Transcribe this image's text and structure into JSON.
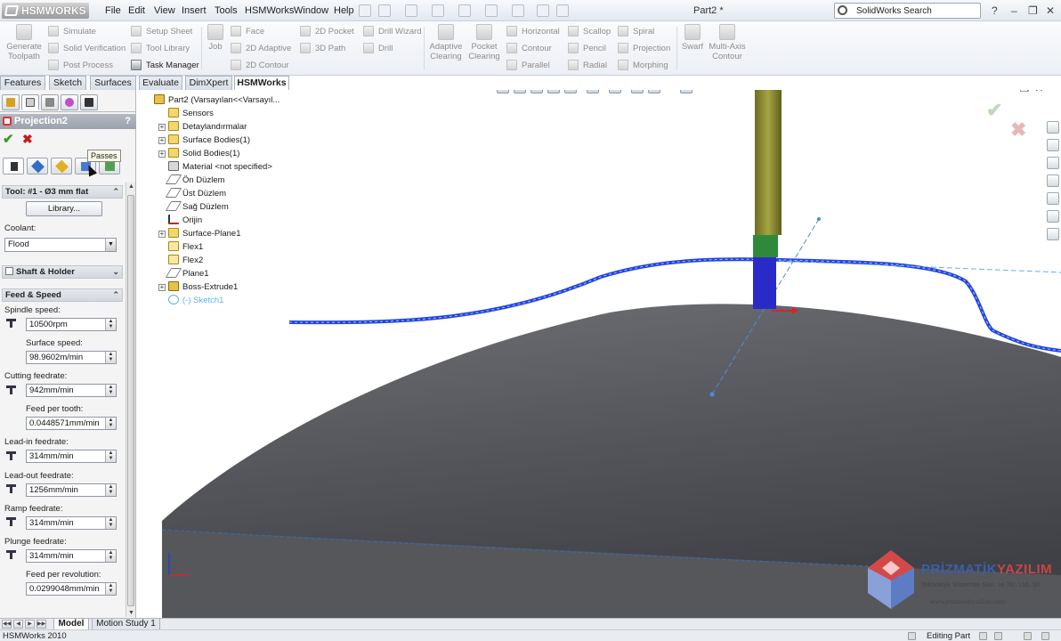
{
  "app": {
    "brand": "HSMWORKS",
    "document_title": "Part2 *"
  },
  "menu": [
    "File",
    "Edit",
    "View",
    "Insert",
    "Tools",
    "HSMWorks",
    "Window",
    "Help"
  ],
  "search": {
    "placeholder": "SolidWorks Search"
  },
  "command_manager": {
    "generate": "Generate Toolpath",
    "col1": [
      "Simulate",
      "Solid Verification",
      "Post Process"
    ],
    "col2": [
      "Setup Sheet",
      "Tool Library",
      "Task Manager"
    ],
    "job": "Job",
    "col3": [
      "Face",
      "2D Adaptive",
      "2D Contour"
    ],
    "col4": [
      "2D Pocket",
      "3D Path"
    ],
    "col5": [
      "Drill Wizard",
      "Drill"
    ],
    "adaptive": "Adaptive Clearing",
    "pocket": "Pocket Clearing",
    "col6": [
      "Horizontal",
      "Contour",
      "Parallel"
    ],
    "col7": [
      "Scallop",
      "Pencil",
      "Radial"
    ],
    "col8": [
      "Spiral",
      "Projection",
      "Morphing"
    ],
    "swarf": "Swarf",
    "multiaxis": "Multi-Axis Contour"
  },
  "tabs": [
    "Features",
    "Sketch",
    "Surfaces",
    "Evaluate",
    "DimXpert",
    "HSMWorks"
  ],
  "active_tab": "HSMWorks",
  "panel": {
    "title": "Projection2",
    "help": "?",
    "tooltip": "Passes",
    "tool_section": "Tool: #1 - Ø3 mm flat",
    "library_button": "Library...",
    "coolant_label": "Coolant:",
    "coolant_value": "Flood",
    "shaft_section": "Shaft & Holder",
    "feed_section": "Feed & Speed",
    "fields": [
      {
        "label": "Spindle speed:",
        "value": "10500rpm"
      },
      {
        "label": "Surface speed:",
        "value": "98.9602m/min"
      },
      {
        "label": "Cutting feedrate:",
        "value": "942mm/min"
      },
      {
        "label": "Feed per tooth:",
        "value": "0.0448571mm/min"
      },
      {
        "label": "Lead-in feedrate:",
        "value": "314mm/min"
      },
      {
        "label": "Lead-out feedrate:",
        "value": "1256mm/min"
      },
      {
        "label": "Ramp feedrate:",
        "value": "314mm/min"
      },
      {
        "label": "Plunge feedrate:",
        "value": "314mm/min"
      },
      {
        "label": "Feed per revolution:",
        "value": "0.0299048mm/min"
      }
    ]
  },
  "tree": [
    "Part2  (Varsayılan<<Varsayıl...",
    "Sensors",
    "Detaylandırmalar",
    "Surface Bodies(1)",
    "Solid Bodies(1)",
    "Material <not specified>",
    "Ön Düzlem",
    "Üst Düzlem",
    "Sağ Düzlem",
    "Orijin",
    "Surface-Plane1",
    "Flex1",
    "Flex2",
    "Plane1",
    "Boss-Extrude1",
    "(-) Sketch1"
  ],
  "watermark": {
    "name_a": "PRİZMATİK",
    "name_b": "YAZILIM",
    "subtitle": "Teknolojik Sistemler San. ve Tic. Ltd. Şti.",
    "url": "www.prizmatikyazilim.com"
  },
  "bottom_tabs": [
    "Model",
    "Motion Study 1"
  ],
  "status": {
    "left": "HSMWorks 2010",
    "mode": "Editing Part"
  },
  "colors": {
    "toolpath": "#2244dd",
    "tool_holder": "#8a8a2e",
    "tool_collar": "#2e8a3a",
    "tool_cutter": "#2a2ac8",
    "part": "#5b5d63"
  }
}
